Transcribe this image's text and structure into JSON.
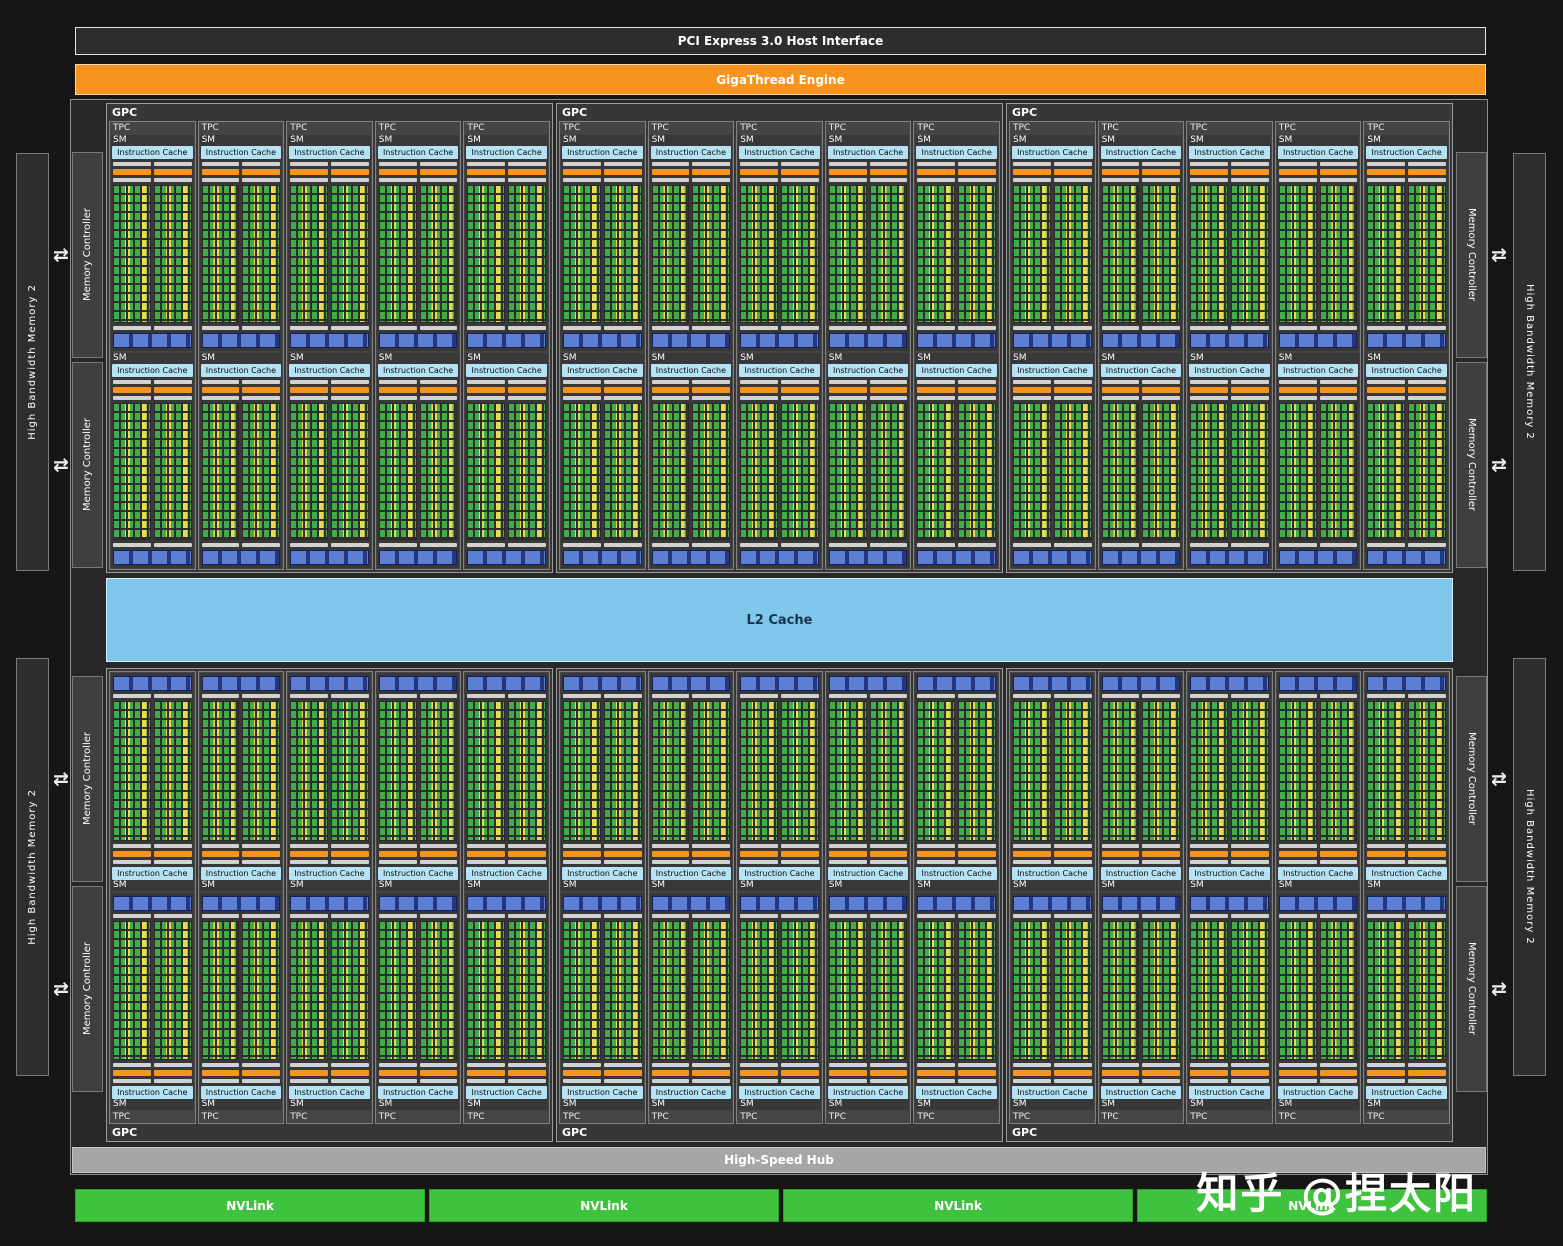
{
  "top_bars": {
    "pcie": "PCI Express 3.0 Host Interface",
    "gigathread": "GigaThread Engine"
  },
  "labels": {
    "gpc": "GPC",
    "tpc": "TPC",
    "sm": "SM",
    "instruction_cache": "Instruction Cache"
  },
  "memory": {
    "controller": "Memory Controller",
    "hbm": "High Bandwidth Memory 2"
  },
  "l2_cache": "L2 Cache",
  "hub": "High-Speed Hub",
  "nvlink": "NVLink",
  "watermark": "知乎 @捏太阳",
  "layout_counts": {
    "gpc_columns": 3,
    "gpc_rows": 2,
    "tpc_per_gpc": 5,
    "sm_per_tpc": 2,
    "nvlink_count": 4,
    "mc_per_side": 4,
    "hbm_per_side": 2
  },
  "colors": {
    "orange": "#f7941d",
    "icache_blue": "#b5e2f5",
    "l2_blue": "#7fc8ec",
    "core_green": "#3fae49",
    "core_yellow": "#ead94f",
    "tex_blue_dark": "#24367e",
    "tex_blue_light": "#5c7fd4",
    "nvlink_green": "#3fc33f",
    "hub_gray": "#a6a6a6"
  }
}
